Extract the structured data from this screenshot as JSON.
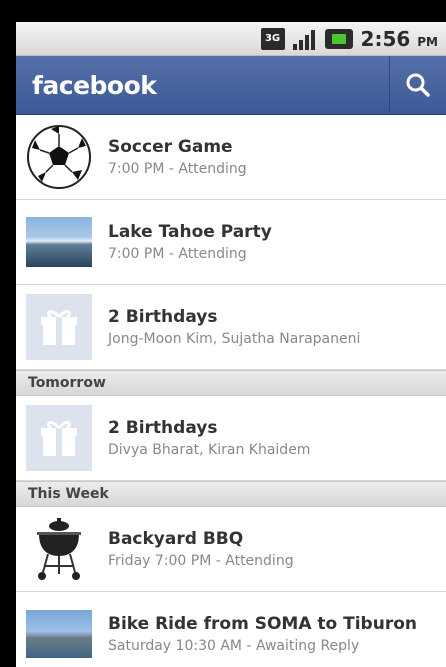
{
  "status_bar": {
    "network": "3G",
    "time": "2:56",
    "ampm": "PM",
    "icons": [
      "3g-icon",
      "signal-icon",
      "battery-icon"
    ]
  },
  "app_bar": {
    "logo": "facebook",
    "search_icon": "search-icon",
    "color": "#3b5998"
  },
  "events": {
    "today": [
      {
        "title": "Soccer Game",
        "subtitle": "7:00 PM - Attending",
        "icon": "soccer-ball-icon"
      },
      {
        "title": "Lake Tahoe Party",
        "subtitle": "7:00 PM - Attending",
        "icon": "lake-photo"
      },
      {
        "title": "2 Birthdays",
        "subtitle": "Jong-Moon Kim, Sujatha Narapaneni",
        "icon": "gift-icon"
      }
    ],
    "tomorrow": {
      "header": "Tomorrow",
      "items": [
        {
          "title": "2 Birthdays",
          "subtitle": "Divya Bharat, Kiran Khaidem",
          "icon": "gift-icon"
        }
      ]
    },
    "this_week": {
      "header": "This Week",
      "items": [
        {
          "title": "Backyard BBQ",
          "subtitle": "Friday 7:00 PM - Attending",
          "icon": "grill-icon"
        },
        {
          "title": "Bike Ride from SOMA to Tiburon",
          "subtitle": "Saturday 10:30 AM - Awaiting Reply",
          "icon": "bay-photo"
        }
      ]
    }
  }
}
